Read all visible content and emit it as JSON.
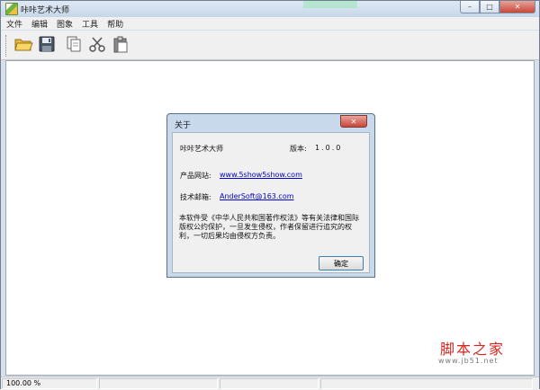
{
  "window": {
    "title": "咔咔艺术大师",
    "minimize_glyph": "–",
    "maximize_glyph": "□",
    "close_glyph": "✕"
  },
  "menu": {
    "items": [
      "文件",
      "编辑",
      "图象",
      "工具",
      "帮助"
    ]
  },
  "toolbar": {
    "buttons": [
      "open-folder-icon",
      "save-disk-icon",
      "copy-icon",
      "cut-scissors-icon",
      "paste-clipboard-icon"
    ]
  },
  "status": {
    "zoom": "100.00 %"
  },
  "dialog": {
    "title": "关于",
    "close_glyph": "✕",
    "app_name": "咔咔艺术大师",
    "version_label": "版本:",
    "version": "1.0.0",
    "website_label": "产品网站:",
    "website": "www.5show5show.com",
    "email_label": "技术邮箱:",
    "email": "AnderSoft@163.com",
    "notice": "本软件受《中华人民共和国著作权法》等有关法律和国际版权公约保护，一旦发生侵权，作者保留进行追究的权利，一切后果均由侵权方负责。",
    "ok_label": "确定"
  },
  "watermark": {
    "title": "脚本之家",
    "url": "www.jb51.net"
  },
  "colors": {
    "accent": "#3c7fb1",
    "close_red": "#c9473a",
    "watermark_red": "#d7261e",
    "link_blue": "#0000cc"
  }
}
